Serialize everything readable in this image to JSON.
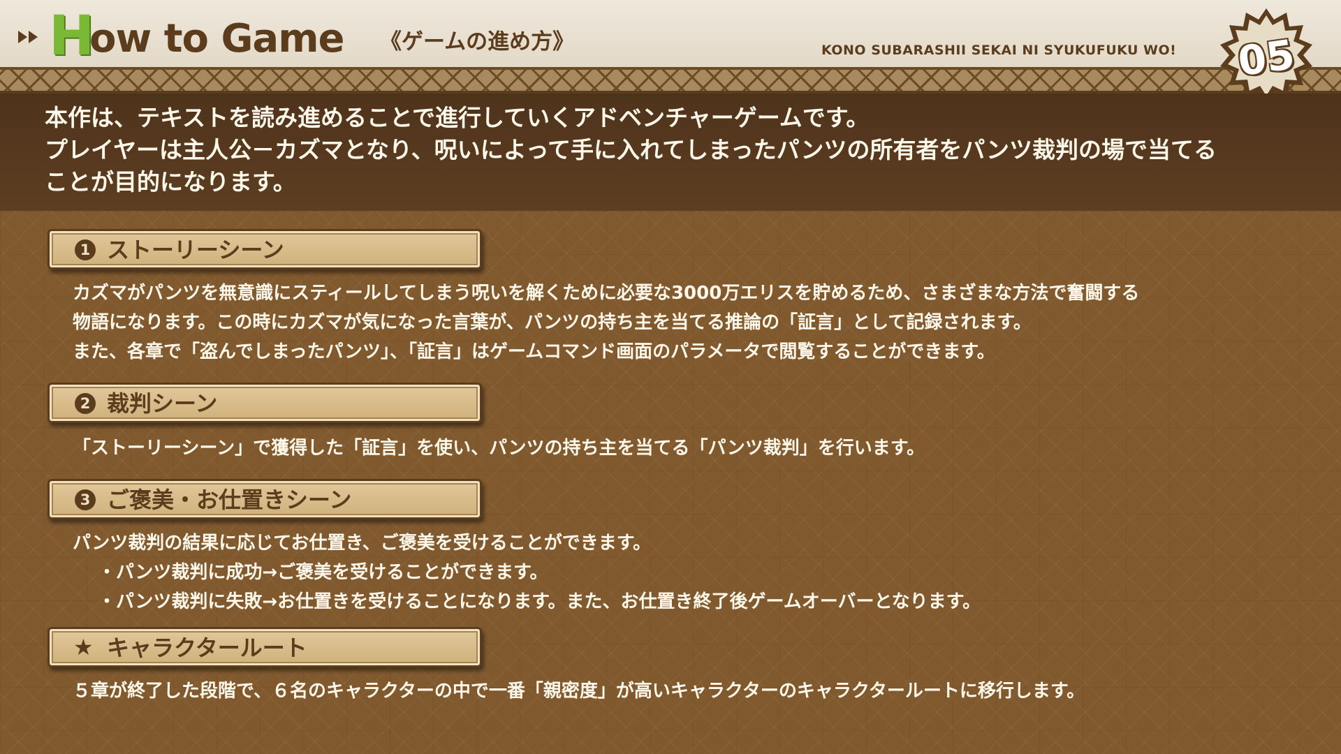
{
  "header": {
    "title_first": "H",
    "title_rest": "ow to Game",
    "title_jp": "《ゲームの進め方》",
    "subtitle_en": "KONO SUBARASHII SEKAI NI SYUKUFUKU WO!",
    "page_number": "05"
  },
  "intro": {
    "lines": [
      "本作は、テキストを読み進めることで進行していくアドベンチャーゲームです。",
      "プレイヤーは主人公－カズマとなり、呪いによって手に入れてしまったパンツの所有者をパンツ裁判の場で当てる",
      "ことが目的になります。"
    ]
  },
  "sections": [
    {
      "num": "1",
      "title": "ストーリーシーン",
      "lines": [
        "カズマがパンツを無意識にスティールしてしまう呪いを解くために必要な3000万エリスを貯めるため、さまざまな方法で奮闘する",
        "物語になります。この時にカズマが気になった言葉が、パンツの持ち主を当てる推論の「証言」として記録されます。",
        "また、各章で「盗んでしまったパンツ」、「証言」はゲームコマンド画面のパラメータで閲覧することができます。"
      ]
    },
    {
      "num": "2",
      "title": "裁判シーン",
      "lines": [
        "「ストーリーシーン」で獲得した「証言」を使い、パンツの持ち主を当てる「パンツ裁判」を行います。"
      ]
    },
    {
      "num": "3",
      "title": "ご褒美・お仕置きシーン",
      "lines": [
        "パンツ裁判の結果に応じてお仕置き、ご褒美を受けることができます。"
      ],
      "bullets": [
        "パンツ裁判に成功→ご褒美を受けることができます。",
        "パンツ裁判に失敗→お仕置きを受けることになります。また、お仕置き終了後ゲームオーバーとなります。"
      ]
    },
    {
      "num": "★",
      "title": "キャラクタールート",
      "lines": [
        "５章が終了した段階で、６名のキャラクターの中で一番「親密度」が高いキャラクターのキャラクタールートに移行します。"
      ]
    }
  ],
  "colors": {
    "brown_dark": "#5b3c1d",
    "green_accent": "#7ab936",
    "text_light": "#fff8ea",
    "panel_tan": "#cfb07a"
  }
}
